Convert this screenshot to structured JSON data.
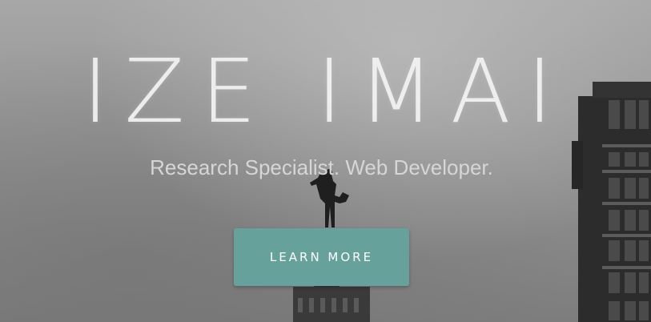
{
  "hero": {
    "title": "IZE IMAI",
    "subtitle": "Research Specialist. Web Developer.",
    "cta_label": "LEARN MORE"
  },
  "colors": {
    "cta_background": "#66a29b",
    "title_text": "#f4f4f4",
    "subtitle_text": "#d6d6d6"
  }
}
